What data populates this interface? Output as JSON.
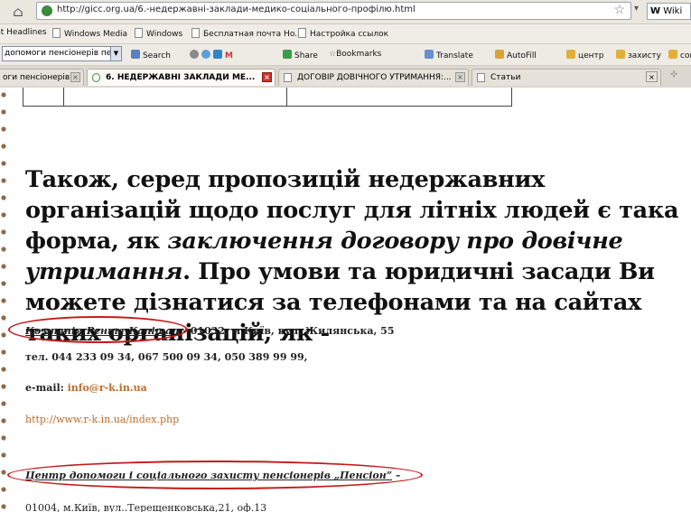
{
  "browser": {
    "url": "http://gicc.org.ua/6.-недержавні-заклади-медико-соціального-профілю.html",
    "wiki_search": "Wiki",
    "bookmarks": [
      "st Headlines",
      "Windows Media",
      "Windows",
      "Бесплатная почта Ho...",
      "Настройка ссылок"
    ],
    "toolbar": {
      "select_value": "допомоги пенсіонерів пенсіо",
      "search": "Search",
      "share": "Share",
      "bookmarks": "Bookmarks",
      "translate": "Translate",
      "autofill": "AutoFill",
      "centre": "центр",
      "protect": "захисту",
      "social": "соц"
    },
    "tabs": [
      {
        "label": "оги пенсіонерів ..."
      },
      {
        "label": "6. НЕДЕРЖАВНІ ЗАКЛАДИ МЕ..."
      },
      {
        "label": "ДОГОВІР ДОВІЧНОГО УТРИМАННЯ:..."
      },
      {
        "label": "Статьи"
      }
    ]
  },
  "page": {
    "lead_part1": "Також, серед пропозицій недержавних організацій щодо послуг для літніх людей є така форма, як ",
    "lead_italic": "заключення договору про довічне утримання",
    "lead_part2": ". Про умови та юридичні засади Ви можете дізнатися за телефонами та на сайтах  таких організацій, як  -",
    "org1": {
      "name": "Компанія Рента-Капітал",
      "address": " - 01032, м.Київ, вул. Жилянська, 55",
      "phones": "тел. 044 233 09 34, 067 500 09 34, 050 389 99 99,",
      "email_label": "e-mail: ",
      "email": "info@r-k.in.ua",
      "website": "http://www.r-k.in.ua/index.php"
    },
    "org2": {
      "name": "Центр допомоги і соціального захисту пенсіонерів „Пенсіон”",
      "dash": " –",
      "address": "01004, м.Київ, вул..Терещенковська,21, оф.13"
    }
  }
}
